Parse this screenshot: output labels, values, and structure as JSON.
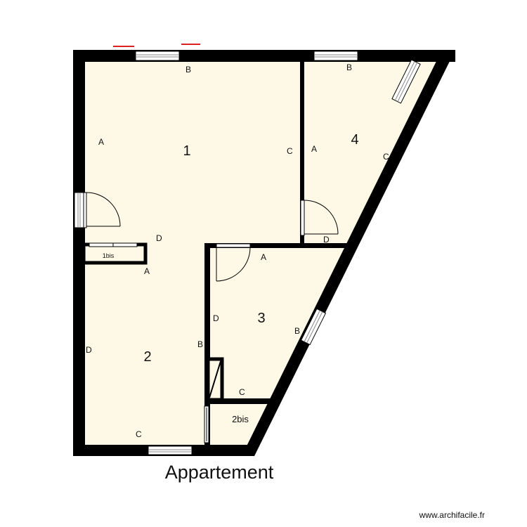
{
  "plan": {
    "title": "Appartement",
    "watermark": "www.archifacile.fr",
    "colors": {
      "floor": "#fdf9e6",
      "wall": "#000000",
      "opening": "#ffffff",
      "marker": "#dd2020"
    },
    "rooms": [
      {
        "id": "1",
        "label": "1"
      },
      {
        "id": "1bis",
        "label": "1bis"
      },
      {
        "id": "2",
        "label": "2"
      },
      {
        "id": "2bis",
        "label": "2bis"
      },
      {
        "id": "3",
        "label": "3"
      },
      {
        "id": "4",
        "label": "4"
      }
    ],
    "wall_labels": {
      "r1_a": "A",
      "r1_b": "B",
      "r1_c": "C",
      "r1_d": "D",
      "r4_a": "A",
      "r4_b": "B",
      "r4_c": "C",
      "r4_d": "D",
      "r2_a": "A",
      "r2_b": "B",
      "r2_c": "C",
      "r2_d": "D",
      "r3_a": "A",
      "r3_b": "B",
      "r3_c": "C",
      "r3_d": "D"
    }
  }
}
